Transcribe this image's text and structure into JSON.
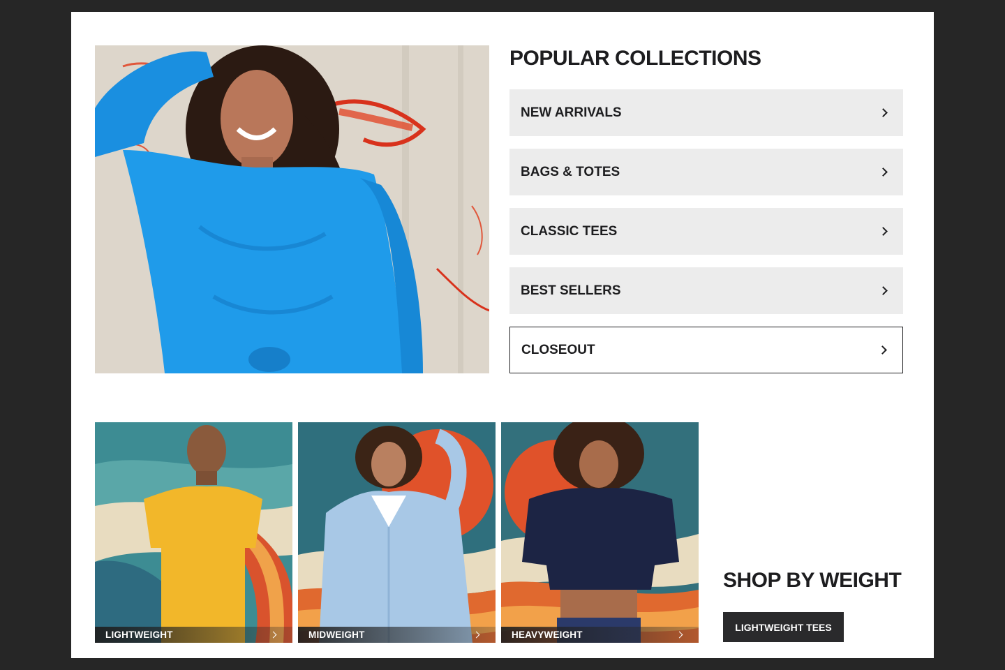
{
  "collections": {
    "title": "POPULAR COLLECTIONS",
    "items": [
      {
        "label": "NEW ARRIVALS"
      },
      {
        "label": "BAGS & TOTES"
      },
      {
        "label": "CLASSIC TEES"
      },
      {
        "label": "BEST SELLERS"
      },
      {
        "label": "CLOSEOUT"
      }
    ]
  },
  "weight_cards": [
    {
      "label": "LIGHTWEIGHT"
    },
    {
      "label": "MIDWEIGHT"
    },
    {
      "label": "HEAVYWEIGHT"
    }
  ],
  "shop_by_weight": {
    "title": "SHOP BY WEIGHT",
    "button_label": "LIGHTWEIGHT TEES"
  },
  "colors": {
    "page_bg": "#262626",
    "panel_bg": "#ffffff",
    "tile_bg": "#ececec",
    "text_dark": "#1d1d1f",
    "button_bg": "#2a2a2c"
  }
}
